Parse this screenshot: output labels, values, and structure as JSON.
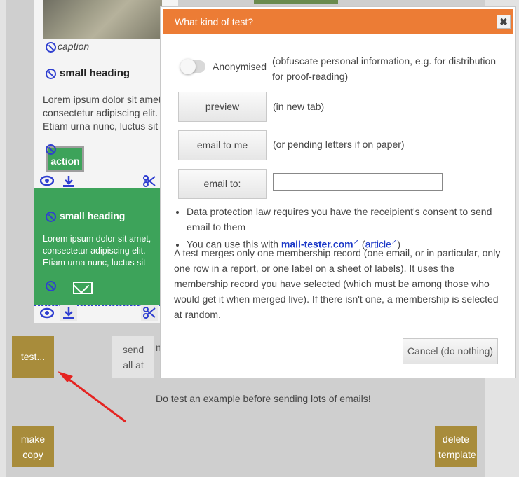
{
  "editor": {
    "caption": "caption",
    "small_heading": "small heading",
    "lorem": "Lorem ipsum dolor sit amet, consectetur adipiscing elit. Etiam urna nunc, luctus sit amet diam ac, finibus varius",
    "action_label": "action",
    "green_heading": "small heading",
    "green_lorem": "Lorem ipsum dolor sit amet, consectetur adipiscing elit. Etiam urna nunc, luctus sit amet diam ac, finibus varius"
  },
  "toolbar": {
    "test_label": "test...",
    "send_all_label": "send all at",
    "send_extra": "n",
    "hint": "Do test an example before sending lots of emails!",
    "make_copy_label": "make copy",
    "delete_template_label": "delete template"
  },
  "modal": {
    "title": "What kind of test?",
    "close": "✖",
    "anonymised_label": "Anonymised",
    "anonymised_desc": "(obfuscate personal information, e.g. for distribution for proof-reading)",
    "preview_label": "preview",
    "preview_desc": "(in new tab)",
    "email_me_label": "email to me",
    "email_me_desc": "(or pending letters if on paper)",
    "email_to_label": "email to:",
    "email_to_value": "",
    "bullet1": "Data protection law requires you have the receipient's consent to send email to them",
    "bullet2_prefix": "You can use this with",
    "bullet2_link": "mail-tester.com",
    "bullet2_article": "article",
    "paragraph": "A test merges only one membership record (one email, or in particular, only one row in a report, or one label on a sheet of labels). It uses the membership record you have selected (which must be among those who would get it when merged live). If there isn't one, a membership is selected at random.",
    "cancel_label": "Cancel (do nothing)"
  },
  "icons": [
    "ban-icon",
    "eye-icon",
    "download-icon",
    "scissors-icon",
    "envelope-icon",
    "close-icon",
    "external-link-icon"
  ],
  "colors": {
    "header": "#ec7c35",
    "gold": "#a88c3b",
    "green": "#3da35a",
    "link": "#1a37c7",
    "arrow": "#e52421"
  }
}
